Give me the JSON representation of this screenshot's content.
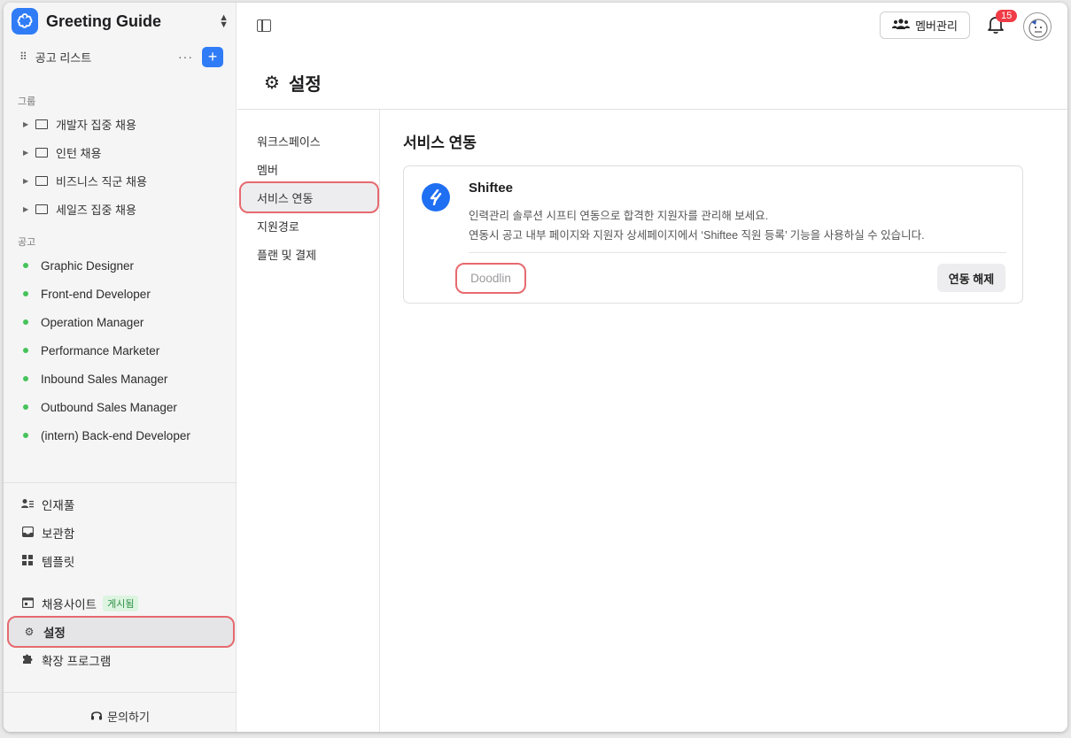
{
  "app": {
    "name": "Greeting Guide",
    "brand_color": "#2f7cf6"
  },
  "sidebar": {
    "job_list_label": "공고 리스트",
    "add_label": "+",
    "groups_label": "그룹",
    "groups": [
      {
        "label": "개발자 집중 채용"
      },
      {
        "label": "인턴 채용"
      },
      {
        "label": "비즈니스 직군 채용"
      },
      {
        "label": "세일즈 집중 채용"
      }
    ],
    "jobs_label": "공고",
    "jobs": [
      {
        "label": "Graphic Designer"
      },
      {
        "label": "Front-end Developer"
      },
      {
        "label": "Operation Manager"
      },
      {
        "label": "Performance Marketer"
      },
      {
        "label": "Inbound Sales Manager"
      },
      {
        "label": "Outbound Sales Manager"
      },
      {
        "label": "(intern) Back-end Developer"
      }
    ],
    "nav": [
      {
        "label": "인재풀",
        "icon": "person-list-icon"
      },
      {
        "label": "보관함",
        "icon": "inbox-icon"
      },
      {
        "label": "템플릿",
        "icon": "grid-icon"
      }
    ],
    "recruit_site": {
      "label": "채용사이트",
      "badge": "게시됨"
    },
    "settings_label": "설정",
    "extensions_label": "확장 프로그램",
    "inquiry_label": "문의하기"
  },
  "header": {
    "member_mgmt_label": "멤버관리",
    "notification_count": "15"
  },
  "page": {
    "title": "설정"
  },
  "sub_nav": [
    {
      "label": "워크스페이스"
    },
    {
      "label": "멤버"
    },
    {
      "label": "서비스 연동"
    },
    {
      "label": "지원경로"
    },
    {
      "label": "플랜 및 결제"
    }
  ],
  "content": {
    "title": "서비스 연동",
    "service": {
      "name": "Shiftee",
      "desc_line1": "인력관리 솔루션 시프티 연동으로 합격한 지원자를 관리해 보세요.",
      "desc_line2": "연동시 공고 내부 페이지와 지원자 상세페이지에서 ‘Shiftee 직원 등록’ 기능을 사용하실 수 있습니다.",
      "workspace": "Doodlin",
      "unlink_label": "연동 해제"
    }
  }
}
